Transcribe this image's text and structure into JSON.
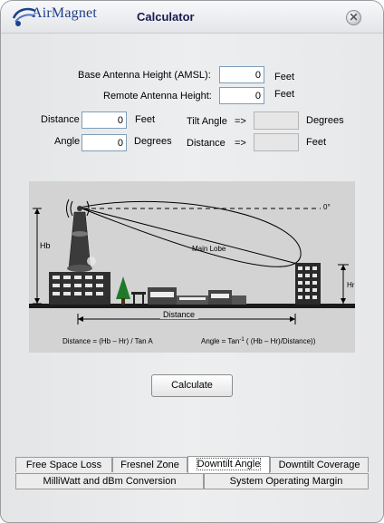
{
  "app": {
    "brand": "AirMagnet",
    "title": "Calculator"
  },
  "form": {
    "base_height_label": "Base Antenna Height (AMSL):",
    "base_height_value": "0",
    "base_height_unit": "Feet",
    "remote_height_label": "Remote Antenna Height:",
    "remote_height_value": "0",
    "remote_height_unit": "Feet",
    "distance_label": "Distance",
    "distance_value": "0",
    "distance_unit": "Feet",
    "angle_label": "Angle",
    "angle_value": "0",
    "angle_unit": "Degrees",
    "tilt_angle_label": "Tilt Angle",
    "tilt_arrow": "=>",
    "tilt_unit": "Degrees",
    "out_distance_label": "Distance",
    "out_distance_arrow": "=>",
    "out_distance_unit": "Feet"
  },
  "diagram": {
    "zero_label": "0°",
    "hb_label": "Hb",
    "hr_label": "Hr",
    "main_lobe_label": "Main Lobe",
    "distance_label": "Distance",
    "formula_distance": "Distance = (Hb – Hr) / Tan A",
    "formula_angle_prefix": "Angle = Tan",
    "formula_angle_sup": "-1",
    "formula_angle_suffix": " ( (Hb – Hr)/Distance))"
  },
  "buttons": {
    "calculate": "Calculate"
  },
  "tabs": {
    "row1": [
      "Free Space Loss",
      "Fresnel Zone",
      "Downtilt Angle",
      "Downtilt Coverage"
    ],
    "row2": [
      "MilliWatt and dBm Conversion",
      "System Operating Margin"
    ],
    "active": "Downtilt Angle"
  },
  "colors": {
    "brand": "#1d3f8c",
    "diagram_bg": "#d3d3d3",
    "title": "#1a1a50"
  }
}
